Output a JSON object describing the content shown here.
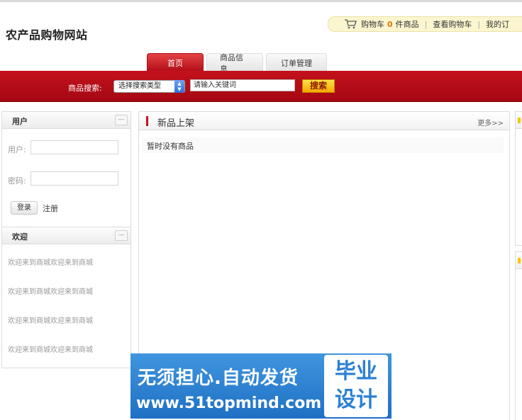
{
  "site": {
    "title": "农产品购物网站"
  },
  "cart": {
    "label": "购物车",
    "count": "0",
    "unit": "件商品",
    "view_cart": "查看购物车",
    "my_orders": "我的订"
  },
  "nav": {
    "tabs": [
      {
        "label": "首页",
        "active": true
      },
      {
        "label": "商品信息",
        "active": false
      },
      {
        "label": "订单管理",
        "active": false
      }
    ]
  },
  "search": {
    "label": "商品搜索:",
    "type_select": "选择搜索类型",
    "placeholder": "请输入关键词",
    "button": "搜索"
  },
  "login": {
    "title": "用户",
    "collapse": "—",
    "user_label": "用户:",
    "password_label": "密码:",
    "login_button": "登录",
    "register_link": "注册"
  },
  "welcome": {
    "title": "欢迎",
    "collapse": "—",
    "lines": [
      "欢迎来到商城欢迎来到商城",
      "欢迎来到商城欢迎来到商城",
      "欢迎来到商城欢迎来到商城",
      "欢迎来到商城欢迎来到商城"
    ]
  },
  "new_products": {
    "title": "新品上架",
    "more": "更多>>",
    "empty": "暂时没有商品"
  },
  "watermark": {
    "main": "无须担心.自动发货",
    "url": "www.51topmind.com",
    "badge_line1": "毕业",
    "badge_line2": "设计"
  },
  "colors": {
    "brand_red": "#c4111d",
    "search_button": "#ffd21a",
    "cart_count": "#e17800",
    "watermark_blue": "#2f84d6"
  }
}
